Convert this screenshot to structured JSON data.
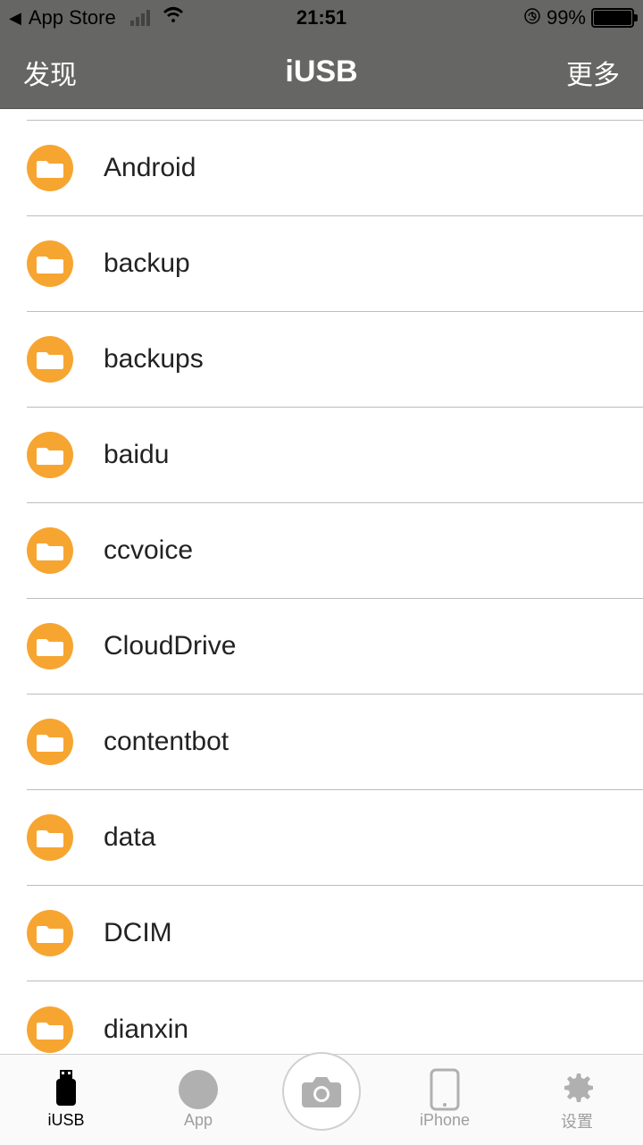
{
  "statusbar": {
    "back_app": "App Store",
    "time": "21:51",
    "battery_pct": "99%"
  },
  "navbar": {
    "left": "发现",
    "title": "iUSB",
    "right": "更多"
  },
  "folders": [
    {
      "name": "Android"
    },
    {
      "name": "backup"
    },
    {
      "name": "backups"
    },
    {
      "name": "baidu"
    },
    {
      "name": "ccvoice"
    },
    {
      "name": "CloudDrive"
    },
    {
      "name": "contentbot"
    },
    {
      "name": "data"
    },
    {
      "name": "DCIM"
    },
    {
      "name": "dianxin"
    }
  ],
  "tabs": {
    "iusb": "iUSB",
    "app": "App",
    "iphone": "iPhone",
    "settings": "设置"
  }
}
